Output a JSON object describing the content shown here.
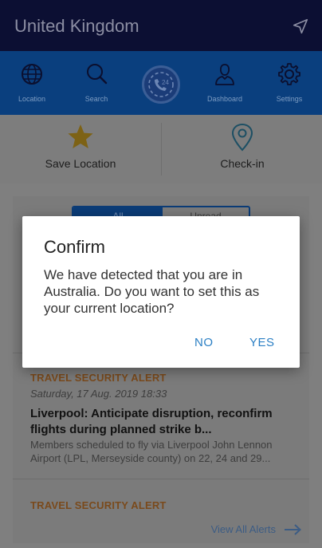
{
  "header": {
    "title": "United Kingdom",
    "nav_icon": "navigation-arrow-icon"
  },
  "tabs": [
    {
      "label": "Location",
      "icon": "globe-icon"
    },
    {
      "label": "Search",
      "icon": "search-icon"
    },
    {
      "label": "Dashboard",
      "icon": "person-icon"
    },
    {
      "label": "Settings",
      "icon": "gear-icon"
    }
  ],
  "center_badge": {
    "icon": "phone-24-icon"
  },
  "actions": {
    "save_location": {
      "label": "Save Location",
      "icon": "star-icon"
    },
    "check_in": {
      "label": "Check-in",
      "icon": "map-pin-icon"
    }
  },
  "segment": {
    "active": "All",
    "inactive": "Unread"
  },
  "alerts": [
    {
      "category": "TRAVEL SECURITY ALERT",
      "date": "Saturday, 17 Aug. 2019 18:33",
      "headline": "Liverpool: Anticipate disruption, reconfirm flights during planned strike b...",
      "summary": "Members scheduled to fly via Liverpool John Lennon Airport (LPL, Merseyside county) on 22, 24 and 29..."
    },
    {
      "category": "TRAVEL SECURITY ALERT"
    }
  ],
  "view_all": "View All Alerts",
  "dialog": {
    "title": "Confirm",
    "message": "We have detected that you are in Australia. Do you want to set this as your current location?",
    "no_label": "NO",
    "yes_label": "YES"
  },
  "colors": {
    "accent": "#2b7fc4",
    "alert_category": "#e0862f",
    "brand_navy": "#1a1f66",
    "tab_blue": "#1675d6"
  }
}
